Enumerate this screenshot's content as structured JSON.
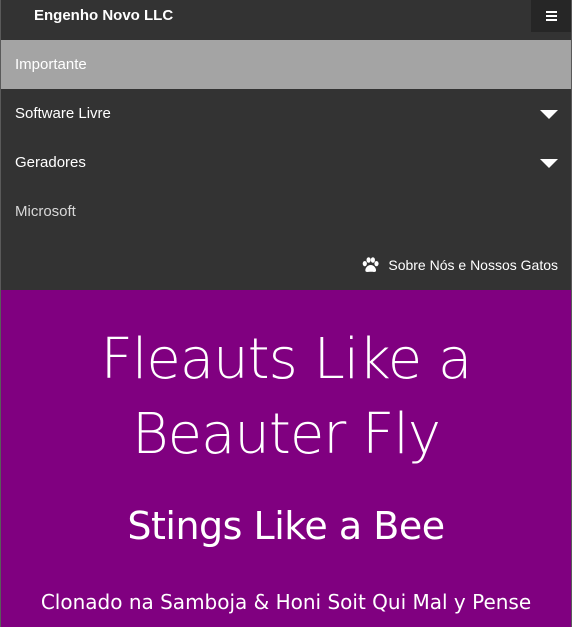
{
  "navbar": {
    "brand": "Engenho Novo LLC",
    "menu_icon": "hamburger-icon"
  },
  "menu": {
    "items": [
      {
        "label": "Importante",
        "active": true
      },
      {
        "label": "Software Livre",
        "dropdown": true
      },
      {
        "label": "Geradores",
        "dropdown": true
      },
      {
        "label": "Microsoft"
      }
    ],
    "about": {
      "label": "Sobre Nós e Nossos Gatos",
      "icon": "paw-icon"
    }
  },
  "hero": {
    "title_line1": "Fleauts Like a",
    "title_line2": "Beauter Fly",
    "subtitle": "Stings Like a Bee",
    "tagline": "Clonado na Samboja & Honi Soit Qui Mal y Pense"
  },
  "colors": {
    "navbar_bg": "#333333",
    "active_item_bg": "#a4a4a4",
    "hero_bg": "#800080",
    "text": "#ffffff"
  }
}
